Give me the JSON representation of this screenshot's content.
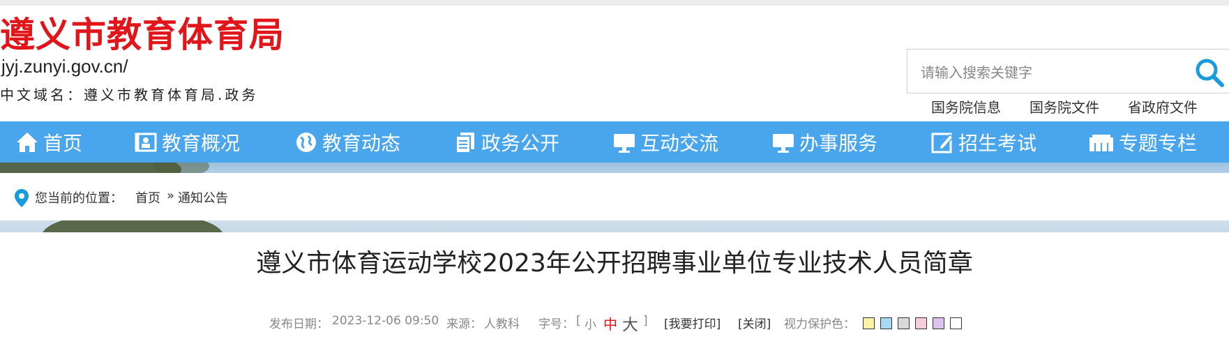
{
  "header": {
    "site_title": "遵义市教育体育局",
    "domain": "jyj.zunyi.gov.cn/",
    "cn_domain": "中文域名：遵义市教育体育局.政务"
  },
  "search": {
    "placeholder": "请输入搜索关键字",
    "icon": "search-icon"
  },
  "gov_links": [
    "国务院信息",
    "国务院文件",
    "省政府文件"
  ],
  "nav": {
    "items": [
      {
        "label": "首页",
        "icon": "home-icon"
      },
      {
        "label": "教育概况",
        "icon": "profile-card-icon"
      },
      {
        "label": "教育动态",
        "icon": "globe-icon"
      },
      {
        "label": "政务公开",
        "icon": "documents-icon"
      },
      {
        "label": "互动交流",
        "icon": "monitor-icon"
      },
      {
        "label": "办事服务",
        "icon": "monitor-icon"
      },
      {
        "label": "招生考试",
        "icon": "edit-icon"
      },
      {
        "label": "专题专栏",
        "icon": "folder-icon"
      }
    ]
  },
  "breadcrumb": {
    "label": "您当前的位置：",
    "home": "首页",
    "separator": "»",
    "current": "通知公告"
  },
  "article": {
    "title": "遵义市体育运动学校2023年公开招聘事业单位专业技术人员简章",
    "publish_label": "发布日期：",
    "publish_date": "2023-12-06 09:50",
    "source_label": "来源：",
    "source": "人教科",
    "font_size_label": "字号：",
    "bracket_open": "[",
    "bracket_close": "]",
    "font_small": "小",
    "font_medium": "中",
    "font_large": "大",
    "print": "[我要打印]",
    "close": "[关闭]",
    "eye_care_label": "视力保护色："
  },
  "eye_care_colors": [
    "#fbf3a8",
    "#a9d8f3",
    "#d9d9d9",
    "#f6cfdb",
    "#dcc2ee",
    "#ffffff"
  ],
  "colors": {
    "brand_red": "#e0161b",
    "nav_blue": "#4aa6ec",
    "font_medium_active": "#e0161b"
  }
}
